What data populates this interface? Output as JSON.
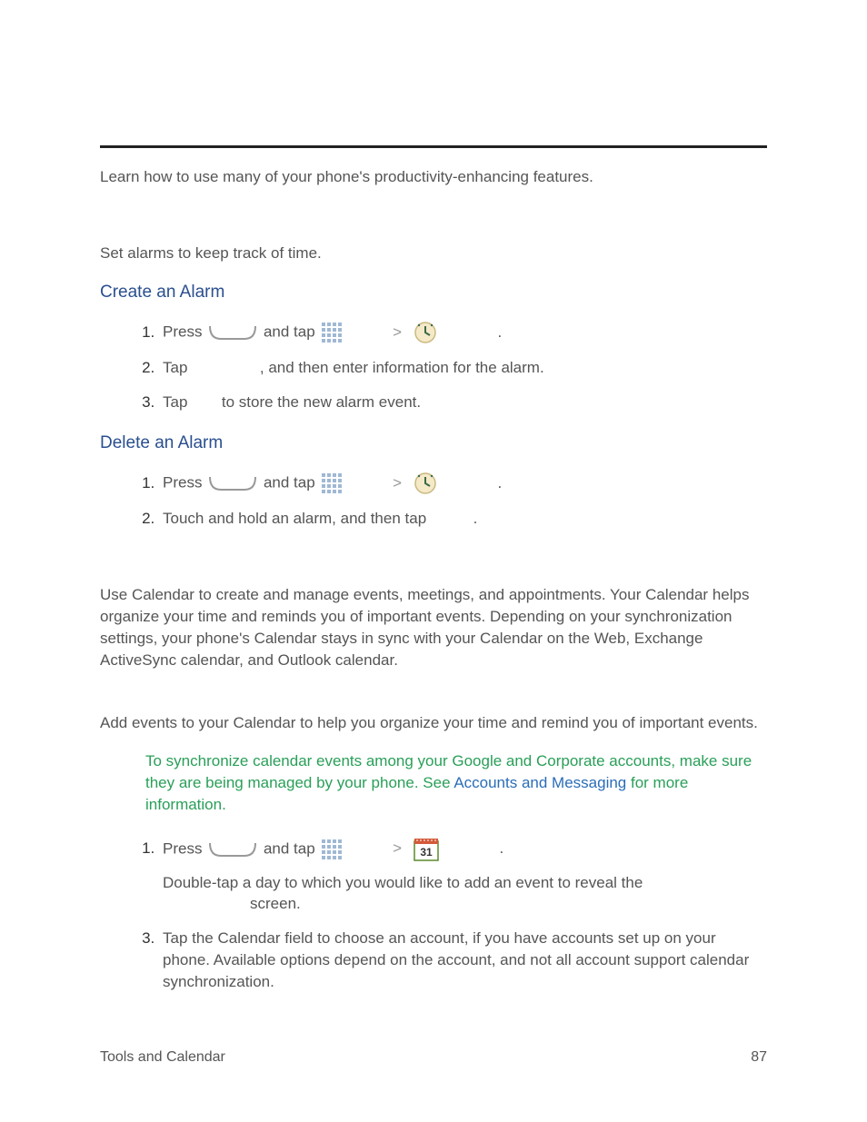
{
  "intro": "Learn how to use many of your phone's productivity-enhancing features.",
  "clock": {
    "desc": "Set alarms to keep track of time.",
    "create": {
      "heading": "Create an Alarm",
      "s1a": "Press",
      "s1b": "and tap",
      "s1c": ">",
      "s2a": "Tap",
      "s2b": ", and then enter information for the alarm.",
      "s3a": "Tap",
      "s3b": "to store the new alarm event."
    },
    "del": {
      "heading": "Delete an Alarm",
      "s1a": "Press",
      "s1b": "and tap",
      "s1c": ">",
      "s2a": "Touch and hold an alarm, and then tap",
      "s2b": "."
    }
  },
  "calendar": {
    "desc": "Use Calendar to create and manage events, meetings, and appointments. Your Calendar helps organize your time and reminds you of important events. Depending on your synchronization settings, your phone's Calendar stays in sync with your Calendar on the Web, Exchange ActiveSync calendar, and Outlook calendar.",
    "add": {
      "desc": "Add events to your Calendar to help you organize your time and remind you of important events.",
      "note_a": "To synchronize calendar events among your Google and Corporate accounts, make sure they are being managed by your phone. See ",
      "note_link": "Accounts and Messaging",
      "note_b": " for more information.",
      "s1a": "Press",
      "s1b": "and tap",
      "s1c": ">",
      "s1d": ".",
      "s2a": "Double-tap a day to which you would like to add an event to reveal the",
      "s2b": "screen.",
      "s3": "Tap the Calendar field to choose an account, if you have accounts set up on your phone. Available options depend on the account, and not all account support calendar synchronization."
    }
  },
  "footer": {
    "left": "Tools and Calendar",
    "right": "87"
  },
  "cal_day": "31"
}
